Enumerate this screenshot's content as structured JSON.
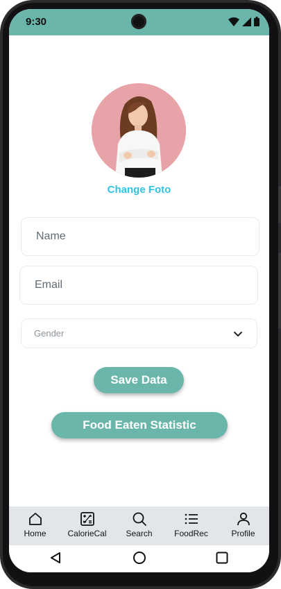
{
  "status": {
    "time": "9:30"
  },
  "profile": {
    "change_photo_label": "Change Foto"
  },
  "form": {
    "name_placeholder": "Name",
    "email_placeholder": "Email",
    "gender_selected": "Gender"
  },
  "actions": {
    "save_label": "Save Data",
    "food_stats_label": "Food Eaten Statistic"
  },
  "bottom_nav": {
    "items": [
      {
        "label": "Home",
        "icon": "home-icon"
      },
      {
        "label": "CalorieCal",
        "icon": "calculator-icon"
      },
      {
        "label": "Search",
        "icon": "search-icon"
      },
      {
        "label": "FoodRec",
        "icon": "list-icon"
      },
      {
        "label": "Profile",
        "icon": "person-icon"
      }
    ]
  },
  "colors": {
    "accent": "#6bb6aa",
    "link": "#2fc4e6",
    "nav_bg": "#e3e6e8",
    "avatar_bg": "#e8a3a9"
  }
}
